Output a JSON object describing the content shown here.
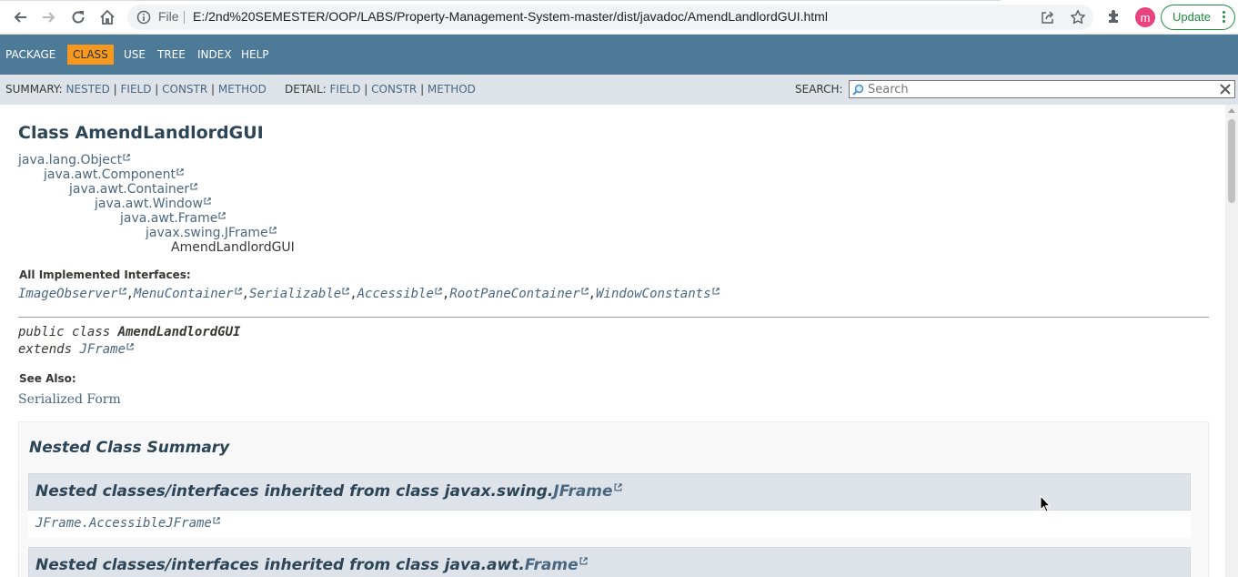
{
  "browser": {
    "scheme": "File",
    "url": "E:/2nd%20SEMESTER/OOP/LABS/Property-Management-System-master/dist/javadoc/AmendLandlordGUI.html",
    "profile_initial": "m",
    "update_label": "Update",
    "icons": [
      "back-icon",
      "forward-icon",
      "reload-icon",
      "home-icon",
      "info-icon",
      "share-icon",
      "star-icon",
      "extensions-icon",
      "more-icon"
    ]
  },
  "topnav": {
    "items": [
      "PACKAGE",
      "CLASS",
      "USE",
      "TREE",
      "INDEX",
      "HELP"
    ],
    "active": "CLASS",
    "active_color": "#f8981d",
    "bar_color": "#4d7a97"
  },
  "subnav": {
    "summary_label": "SUMMARY:",
    "summary_links": [
      "NESTED",
      "FIELD",
      "CONSTR",
      "METHOD"
    ],
    "detail_label": "DETAIL:",
    "detail_links": [
      "FIELD",
      "CONSTR",
      "METHOD"
    ],
    "search_label": "SEARCH:",
    "search_placeholder": "Search",
    "search_value": ""
  },
  "page": {
    "title": "Class AmendLandlordGUI",
    "inheritance": [
      "java.lang.Object",
      "java.awt.Component",
      "java.awt.Container",
      "java.awt.Window",
      "java.awt.Frame",
      "javax.swing.JFrame",
      "AmendLandlordGUI"
    ],
    "interfaces_label": "All Implemented Interfaces:",
    "interfaces": [
      "ImageObserver",
      "MenuContainer",
      "Serializable",
      "Accessible",
      "RootPaneContainer",
      "WindowConstants"
    ],
    "signature_line1_prefix": "public class ",
    "signature_line1_name": "AmendLandlordGUI",
    "signature_line2_prefix": "extends ",
    "signature_line2_link": "JFrame",
    "see_also_label": "See Also:",
    "see_also_link": "Serialized Form"
  },
  "nested_summary": {
    "heading": "Nested Class Summary",
    "blocks": [
      {
        "prefix": "Nested classes/interfaces inherited from class javax.swing.",
        "link": "JFrame",
        "items": [
          "JFrame.AccessibleJFrame"
        ]
      },
      {
        "prefix": "Nested classes/interfaces inherited from class java.awt.",
        "link": "Frame",
        "items": []
      }
    ]
  }
}
